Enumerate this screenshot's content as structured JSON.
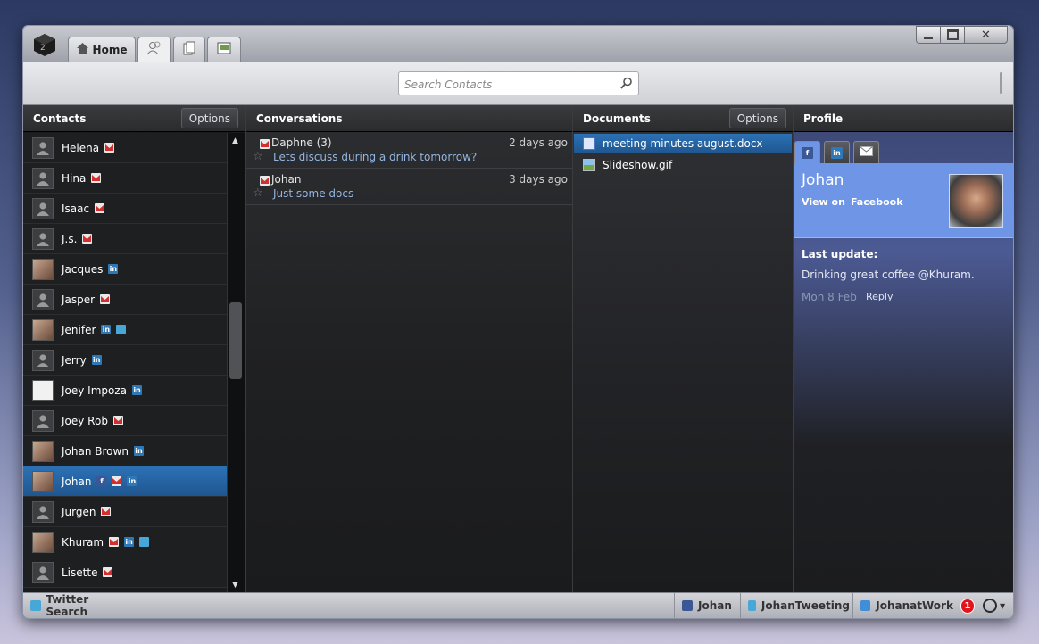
{
  "window": {
    "tabs": [
      {
        "label": "Home",
        "icon": "home-icon"
      },
      {
        "label": "",
        "icon": "contacts-icon"
      },
      {
        "label": "",
        "icon": "documents-icon"
      },
      {
        "label": "",
        "icon": "pictures-icon"
      }
    ],
    "controls": [
      "minimize-icon",
      "maximize-icon",
      "close-icon"
    ]
  },
  "search": {
    "placeholder": "Search Contacts"
  },
  "contacts": {
    "title": "Contacts",
    "options_label": "Options",
    "items": [
      {
        "name": "Helena",
        "services": [
          "gmail"
        ]
      },
      {
        "name": "Hina",
        "services": [
          "gmail"
        ]
      },
      {
        "name": "Isaac",
        "services": [
          "gmail"
        ]
      },
      {
        "name": "J.s.",
        "services": [
          "gmail"
        ]
      },
      {
        "name": "Jacques",
        "services": [
          "linkedin"
        ]
      },
      {
        "name": "Jasper",
        "services": [
          "gmail"
        ]
      },
      {
        "name": "Jenifer",
        "services": [
          "linkedin",
          "twitter"
        ]
      },
      {
        "name": "Jerry",
        "services": [
          "linkedin"
        ]
      },
      {
        "name": "Joey Impoza",
        "services": [
          "linkedin"
        ]
      },
      {
        "name": "Joey Rob",
        "services": [
          "gmail"
        ]
      },
      {
        "name": "Johan Brown",
        "services": [
          "linkedin"
        ]
      },
      {
        "name": "Johan",
        "services": [
          "facebook",
          "gmail",
          "linkedin"
        ],
        "selected": true
      },
      {
        "name": "Jurgen",
        "services": [
          "gmail"
        ]
      },
      {
        "name": "Khuram",
        "services": [
          "gmail",
          "linkedin",
          "twitter"
        ]
      },
      {
        "name": "Lisette",
        "services": [
          "gmail"
        ]
      }
    ]
  },
  "conversations": {
    "title": "Conversations",
    "items": [
      {
        "from": "Daphne (3)",
        "when": "2 days ago",
        "subject": "Lets discuss during a drink tomorrow?"
      },
      {
        "from": "Johan",
        "when": "3 days ago",
        "subject": "Just some docs"
      }
    ]
  },
  "documents": {
    "title": "Documents",
    "options_label": "Options",
    "items": [
      {
        "name": "meeting minutes august.docx",
        "selected": true
      },
      {
        "name": "Slideshow.gif"
      }
    ]
  },
  "profile": {
    "title": "Profile",
    "tabs": [
      "facebook-icon",
      "linkedin-icon",
      "email-icon"
    ],
    "name": "Johan",
    "view_on": "View on",
    "network": "Facebook",
    "last_update_label": "Last update:",
    "status": "Drinking great coffee @Khuram.",
    "date": "Mon 8 Feb",
    "reply_label": "Reply"
  },
  "bottombar": {
    "left_item": "Twitter Search",
    "accounts": [
      {
        "label": "Johan",
        "icon": "facebook-icon"
      },
      {
        "label": "JohanTweeting",
        "icon": "twitter-icon"
      },
      {
        "label": "JohanatWork",
        "icon": "yammer-icon",
        "badge": "1"
      }
    ]
  },
  "colors": {
    "selection": "#2666a6",
    "profile_card": "#6e95e6",
    "badge": "#e3141b"
  }
}
